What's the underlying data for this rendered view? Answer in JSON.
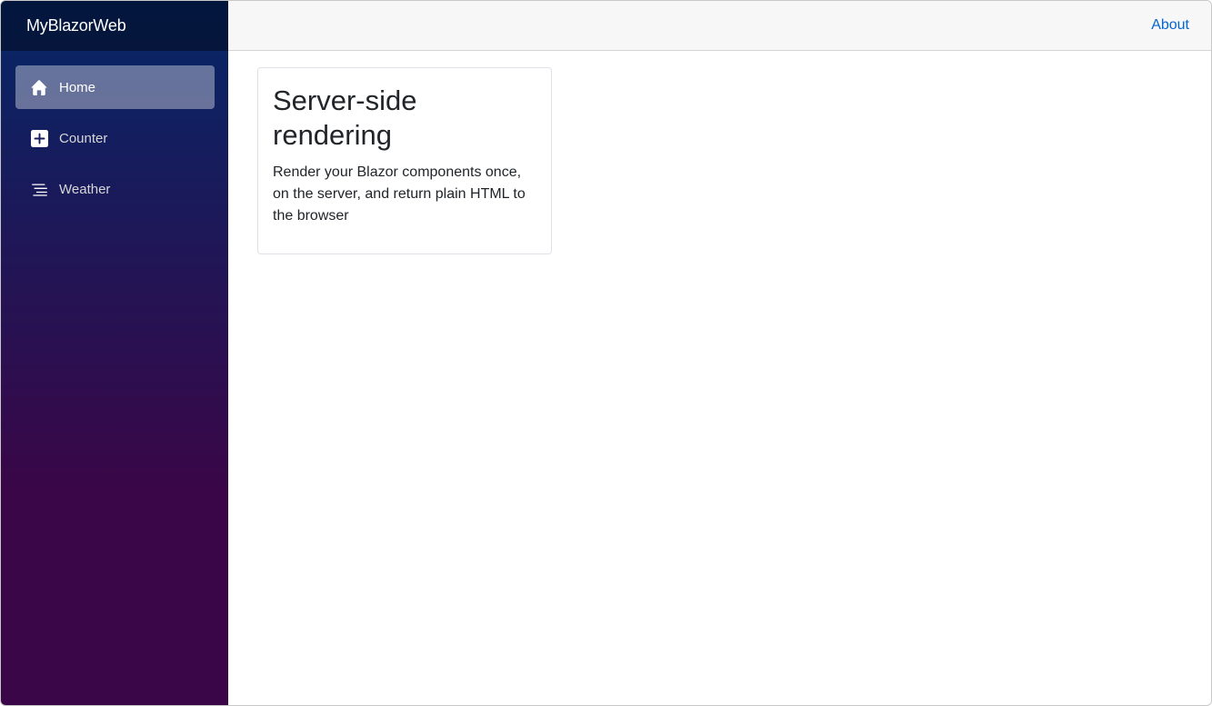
{
  "app": {
    "brand": "MyBlazorWeb"
  },
  "sidebar": {
    "items": [
      {
        "label": "Home",
        "icon": "home-icon",
        "active": true
      },
      {
        "label": "Counter",
        "icon": "plus-square-icon",
        "active": false
      },
      {
        "label": "Weather",
        "icon": "list-nested-icon",
        "active": false
      }
    ]
  },
  "header": {
    "about_label": "About"
  },
  "main": {
    "card": {
      "title": "Server-side rendering",
      "text": "Render your Blazor components once, on the server, and return plain HTML to the browser"
    }
  },
  "colors": {
    "sidebar_top": "#052767",
    "sidebar_bottom": "#3a0647",
    "link": "#0366d6",
    "top_row_bg": "#f7f7f7"
  }
}
